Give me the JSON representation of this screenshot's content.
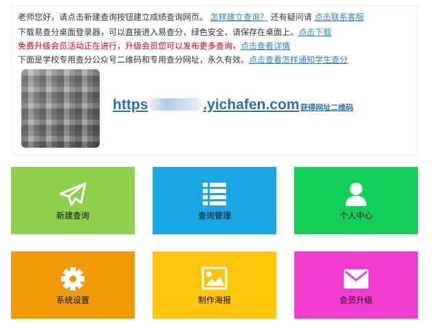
{
  "notice": {
    "line1": {
      "text": "老师您好，请点击新建查询按钮建立成绩查询网页。",
      "link1": "怎样建立查询？",
      "mid": " 还有疑问请 ",
      "link2": "点击联系客服"
    },
    "line2": {
      "text": "下载易查分桌面登录器，可以直接进入易查分，绿色安全，请保存在桌面上。",
      "link": "点击下载"
    },
    "line3": {
      "text": "免费升级会员活动正在进行，升级会员您可以发布更多查询，",
      "link": "点击查看详情"
    },
    "line4": {
      "text": "下面是学校专用查分公众号二维码和专用查分网址，永久有效。",
      "link": "点击查看怎样通知学生查分"
    }
  },
  "site": {
    "url_prefix": "https",
    "url_suffix": ".yichafen.com",
    "qr_link": "获得网址二维码"
  },
  "tiles": [
    {
      "label": "新建查询",
      "icon": "paper-plane-icon",
      "color": "#8ed04b"
    },
    {
      "label": "查询管理",
      "icon": "list-icon",
      "color": "#19a6e5"
    },
    {
      "label": "个人中心",
      "icon": "user-icon",
      "color": "#14cf5a"
    },
    {
      "label": "系统设置",
      "icon": "gear-icon",
      "color": "#f09a07"
    },
    {
      "label": "制作海报",
      "icon": "image-icon",
      "color": "#fec50a"
    },
    {
      "label": "会员升级",
      "icon": "envelope-icon",
      "color": "#f53cd0"
    }
  ]
}
